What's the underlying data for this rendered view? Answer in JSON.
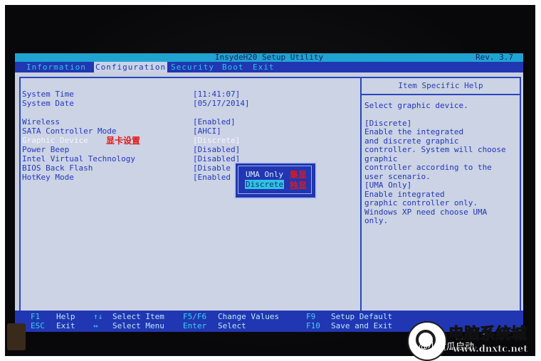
{
  "title_bar": {
    "title": "InsydeH20 Setup Utility",
    "rev": "Rev. 3.7"
  },
  "menu": {
    "items": [
      "Information",
      "Configuration",
      "Security",
      "Boot",
      "Exit"
    ],
    "active": "Configuration"
  },
  "settings": [
    {
      "label": "System Time",
      "value": "[11:41:07]"
    },
    {
      "label": "System Date",
      "value": "[05/17/2014]"
    },
    {
      "label": "Wireless",
      "value": "[Enabled]"
    },
    {
      "label": "SATA Controller Mode",
      "value": "[AHCI]"
    },
    {
      "label": "Graphic Device",
      "value": "[Discrete]",
      "selected": true,
      "annotation": "显卡设置"
    },
    {
      "label": "Power Beep",
      "value": "[Disabled]"
    },
    {
      "label": "Intel Virtual Technology",
      "value": "[Disabled]"
    },
    {
      "label": "BIOS Back Flash",
      "value": "[Disable"
    },
    {
      "label": "HotKey Mode",
      "value": "[Enabled"
    }
  ],
  "popup": {
    "options": [
      {
        "label": "UMA Only",
        "note": "集显"
      },
      {
        "label": "Discrete",
        "note": "独显",
        "selected": true
      }
    ]
  },
  "help": {
    "title": "Item Specific Help",
    "lines": [
      "Select graphic device.",
      "",
      "[Discrete]",
      "Enable the integrated",
      "and discrete graphic",
      "controller. System will choose",
      "graphic",
      "controller according to the",
      "user scenario.",
      "[UMA Only]",
      "Enable integrated",
      "graphic controller only.",
      "Windows XP need choose UMA",
      "only."
    ]
  },
  "footer": {
    "row1": [
      {
        "key": "F1",
        "desc": "Help"
      },
      {
        "key": "↑↓",
        "desc": "Select Item"
      },
      {
        "key": "F5/F6",
        "desc": "Change Values"
      },
      {
        "key": "F9",
        "desc": "Setup Default"
      }
    ],
    "row2": [
      {
        "key": "ESC",
        "desc": "Exit"
      },
      {
        "key": "↔",
        "desc": "Select Menu"
      },
      {
        "key": "Enter",
        "desc": "Select"
      },
      {
        "key": "F10",
        "desc": "Save and Exit"
      }
    ]
  },
  "watermark": {
    "site_name": "电脑系统城",
    "handle": "@小黄瓜启动",
    "url": "www.dnxtc.net"
  }
}
